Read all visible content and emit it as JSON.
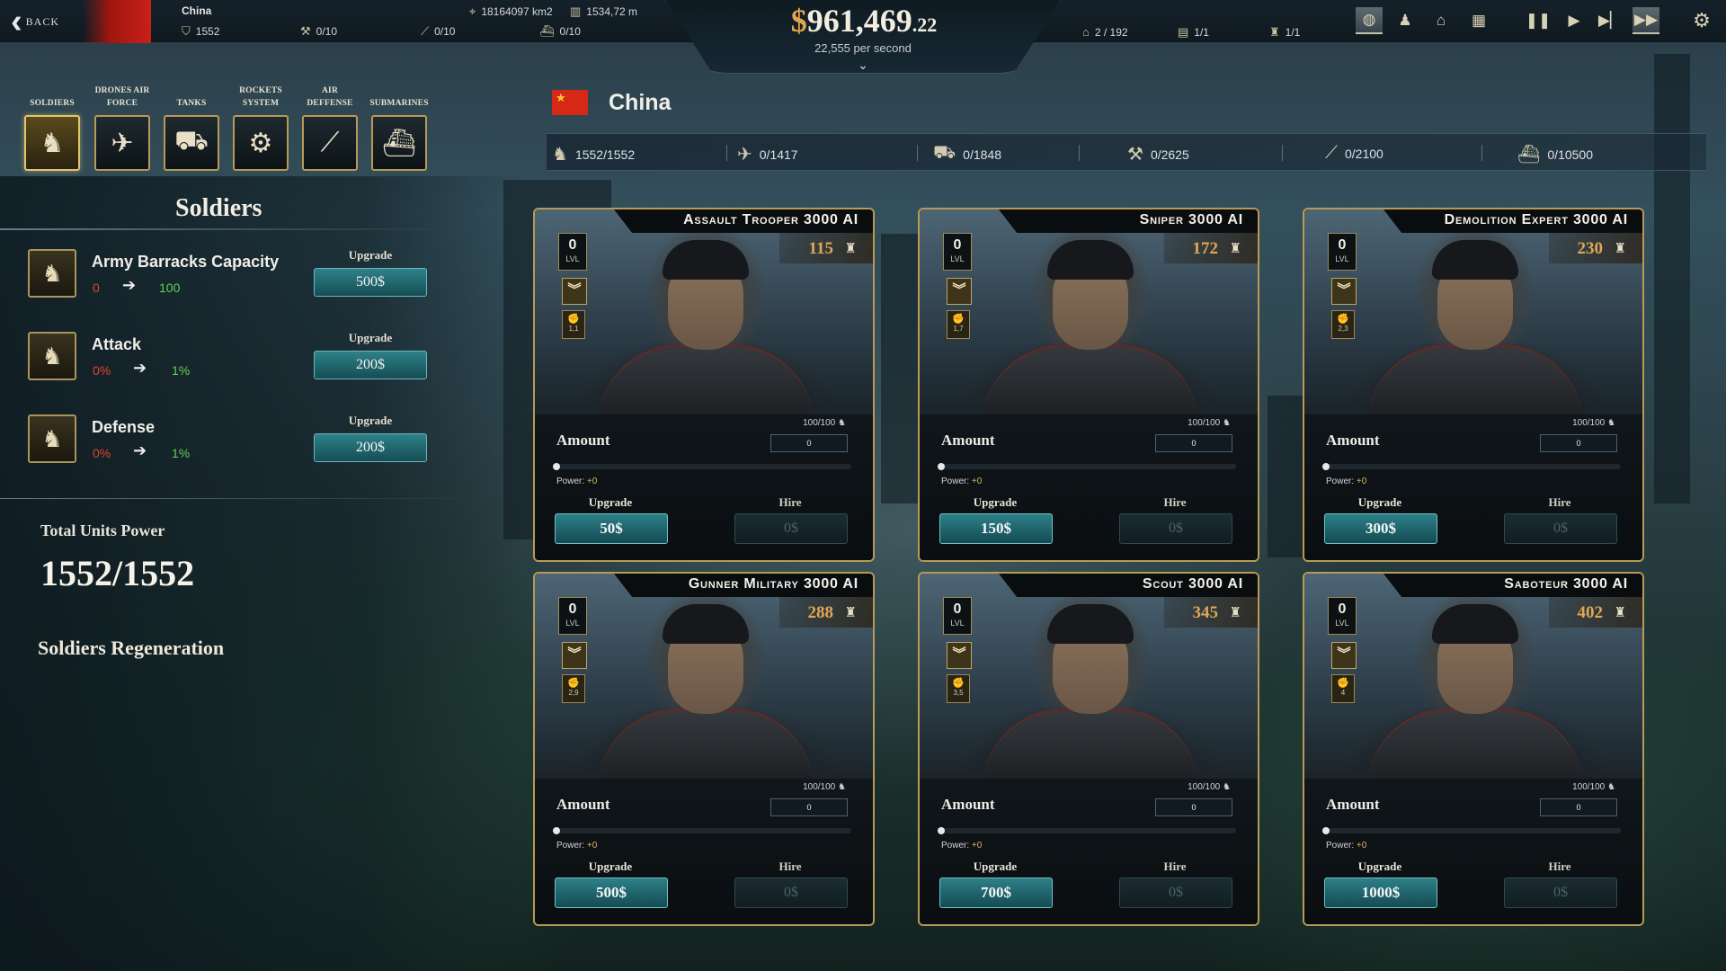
{
  "topbar": {
    "back_label": "BACK",
    "country": "China",
    "soldiers": "1552",
    "stat_a": "0/10",
    "stat_b": "0/10",
    "stat_c": "0/10",
    "area": "18164097 km2",
    "distance": "1534,72 m",
    "money_symbol": "$",
    "money_main": "961,469",
    "money_cents": ".22",
    "per_second": "22,555 per second",
    "right_stats": [
      "2 / 192",
      "1/1",
      "1/1"
    ]
  },
  "categories": [
    {
      "label": "SOLDIERS",
      "icon": "soldier-icon",
      "selected": true
    },
    {
      "label": "DRONES AIR FORCE",
      "icon": "drone-icon",
      "selected": false
    },
    {
      "label": "TANKS",
      "icon": "tank-icon",
      "selected": false
    },
    {
      "label": "ROCKETS SYSTEM",
      "icon": "rocket-launcher-icon",
      "selected": false
    },
    {
      "label": "AIR DEFFENSE",
      "icon": "anti-air-icon",
      "selected": false
    },
    {
      "label": "SUBMARINES",
      "icon": "submarine-icon",
      "selected": false
    }
  ],
  "country_header": {
    "name": "China",
    "units": [
      "1552/1552",
      "0/1417",
      "0/1848",
      "0/2625",
      "0/2100",
      "0/10500"
    ]
  },
  "left_panel": {
    "title": "Soldiers",
    "stats": [
      {
        "name": "Army Barracks Capacity",
        "from": "0",
        "to": "100",
        "upgrade_label": "Upgrade",
        "price": "500$"
      },
      {
        "name": "Attack",
        "from": "0%",
        "to": "1%",
        "upgrade_label": "Upgrade",
        "price": "200$"
      },
      {
        "name": "Defense",
        "from": "0%",
        "to": "1%",
        "upgrade_label": "Upgrade",
        "price": "200$"
      }
    ],
    "total_label": "Total Units Power",
    "total_value": "1552/1552",
    "regen_label": "Soldiers Regeneration"
  },
  "cards": [
    {
      "title": "Assault Trooper 3000 AI",
      "price": "115",
      "level": "0",
      "level_label": "LVL",
      "small_value": "1,1",
      "count": "100/100",
      "amount_label": "Amount",
      "amount_value": "0",
      "power_label": "Power:",
      "power_value": "+0",
      "upgrade_label": "Upgrade",
      "upgrade_price": "50$",
      "hire_label": "Hire",
      "hire_price": "0$"
    },
    {
      "title": "Sniper 3000 AI",
      "price": "172",
      "level": "0",
      "level_label": "LVL",
      "small_value": "1,7",
      "count": "100/100",
      "amount_label": "Amount",
      "amount_value": "0",
      "power_label": "Power:",
      "power_value": "+0",
      "upgrade_label": "Upgrade",
      "upgrade_price": "150$",
      "hire_label": "Hire",
      "hire_price": "0$"
    },
    {
      "title": "Demolition Expert 3000 AI",
      "price": "230",
      "level": "0",
      "level_label": "LVL",
      "small_value": "2,3",
      "count": "100/100",
      "amount_label": "Amount",
      "amount_value": "0",
      "power_label": "Power:",
      "power_value": "+0",
      "upgrade_label": "Upgrade",
      "upgrade_price": "300$",
      "hire_label": "Hire",
      "hire_price": "0$"
    },
    {
      "title": "Gunner Military 3000 AI",
      "price": "288",
      "level": "0",
      "level_label": "LVL",
      "small_value": "2,9",
      "count": "100/100",
      "amount_label": "Amount",
      "amount_value": "0",
      "power_label": "Power:",
      "power_value": "+0",
      "upgrade_label": "Upgrade",
      "upgrade_price": "500$",
      "hire_label": "Hire",
      "hire_price": "0$"
    },
    {
      "title": "Scout 3000 AI",
      "price": "345",
      "level": "0",
      "level_label": "LVL",
      "small_value": "3,5",
      "count": "100/100",
      "amount_label": "Amount",
      "amount_value": "0",
      "power_label": "Power:",
      "power_value": "+0",
      "upgrade_label": "Upgrade",
      "upgrade_price": "700$",
      "hire_label": "Hire",
      "hire_price": "0$"
    },
    {
      "title": "Saboteur 3000 AI",
      "price": "402",
      "level": "0",
      "level_label": "LVL",
      "small_value": "4",
      "count": "100/100",
      "amount_label": "Amount",
      "amount_value": "0",
      "power_label": "Power:",
      "power_value": "+0",
      "upgrade_label": "Upgrade",
      "upgrade_price": "1000$",
      "hire_label": "Hire",
      "hire_price": "0$"
    }
  ],
  "colors": {
    "gold": "#b79a55",
    "money_accent": "#e3a64c",
    "teal_button": "#2d8088",
    "stat_down": "#e2452e",
    "stat_up": "#64cf52",
    "flag_red": "#d72816"
  }
}
